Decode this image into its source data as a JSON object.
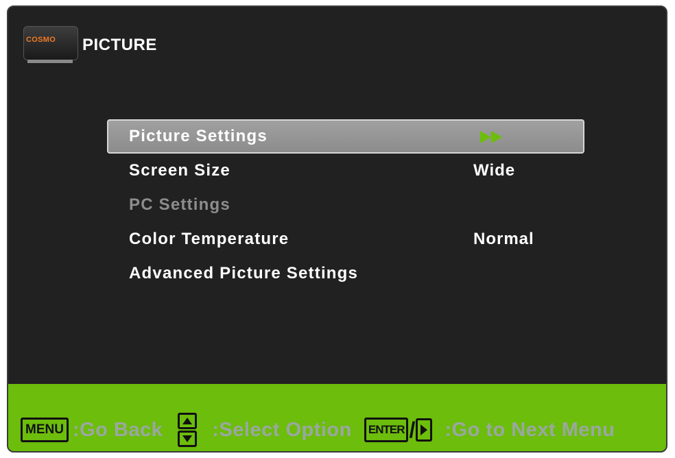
{
  "header": {
    "logo_text": "COSMO",
    "title": "PICTURE"
  },
  "menu": {
    "items": [
      {
        "label": "Picture Settings",
        "value": "",
        "state": "selected",
        "icon": "double-play-arrow-icon"
      },
      {
        "label": "Screen Size",
        "value": "Wide",
        "state": "normal"
      },
      {
        "label": "PC Settings",
        "value": "",
        "state": "disabled"
      },
      {
        "label": "Color Temperature",
        "value": "Normal",
        "state": "normal"
      },
      {
        "label": "Advanced Picture Settings",
        "value": "",
        "state": "normal"
      }
    ]
  },
  "footer": {
    "menu_key": "MENU",
    "go_back": ":Go Back",
    "select_option": ":Select Option",
    "enter_key": "ENTER",
    "slash": "/",
    "go_next": ":Go to Next Menu"
  },
  "colors": {
    "background": "#212121",
    "footer_bar": "#6cbd0c",
    "selection": "#9a9a9a",
    "accent_arrow": "#6cbd0c",
    "hint_text": "#9aa7a1",
    "disabled_text": "#8d8d8d"
  }
}
